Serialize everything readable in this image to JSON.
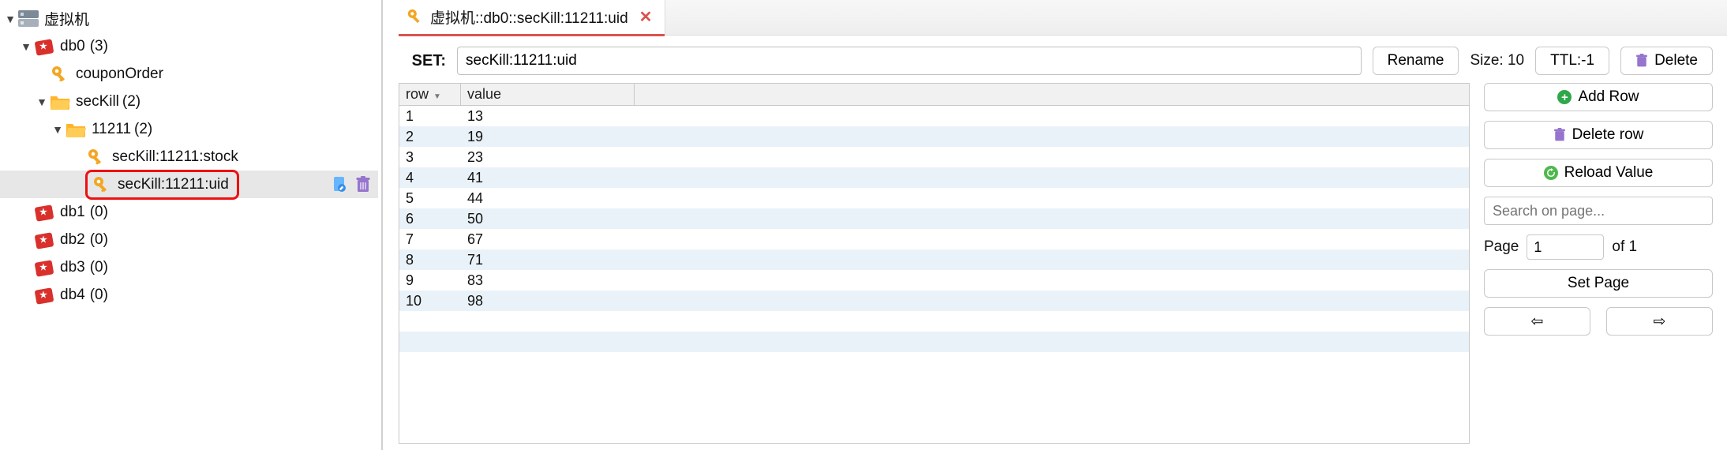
{
  "tree": {
    "root": {
      "label": "虚拟机"
    },
    "db0": {
      "label": "db0",
      "count": "(3)"
    },
    "couponOrder": {
      "label": "couponOrder"
    },
    "secKill_folder": {
      "label": "secKill",
      "count": "(2)"
    },
    "folder_11211": {
      "label": "11211",
      "count": "(2)"
    },
    "key_stock": {
      "label": "secKill:11211:stock"
    },
    "key_uid": {
      "label": "secKill:11211:uid"
    },
    "db1": {
      "label": "db1",
      "count": "(0)"
    },
    "db2": {
      "label": "db2",
      "count": "(0)"
    },
    "db3": {
      "label": "db3",
      "count": "(0)"
    },
    "db4": {
      "label": "db4",
      "count": "(0)"
    }
  },
  "tab": {
    "title": "虚拟机::db0::secKill:11211:uid"
  },
  "toolbar": {
    "set_label": "SET:",
    "key_value": "secKill:11211:uid",
    "rename_label": "Rename",
    "size_label": "Size: 10",
    "ttl_label": "TTL:-1",
    "delete_label": "Delete"
  },
  "table": {
    "header_row": "row",
    "header_value": "value",
    "rows": [
      {
        "row": "1",
        "value": "13"
      },
      {
        "row": "2",
        "value": "19"
      },
      {
        "row": "3",
        "value": "23"
      },
      {
        "row": "4",
        "value": "41"
      },
      {
        "row": "5",
        "value": "44"
      },
      {
        "row": "6",
        "value": "50"
      },
      {
        "row": "7",
        "value": "67"
      },
      {
        "row": "8",
        "value": "71"
      },
      {
        "row": "9",
        "value": "83"
      },
      {
        "row": "10",
        "value": "98"
      }
    ]
  },
  "actions": {
    "add_row": "Add Row",
    "delete_row": "Delete row",
    "reload": "Reload Value",
    "search_placeholder": "Search on page...",
    "page_label": "Page",
    "page_value": "1",
    "page_of": "of 1",
    "set_page": "Set Page"
  }
}
